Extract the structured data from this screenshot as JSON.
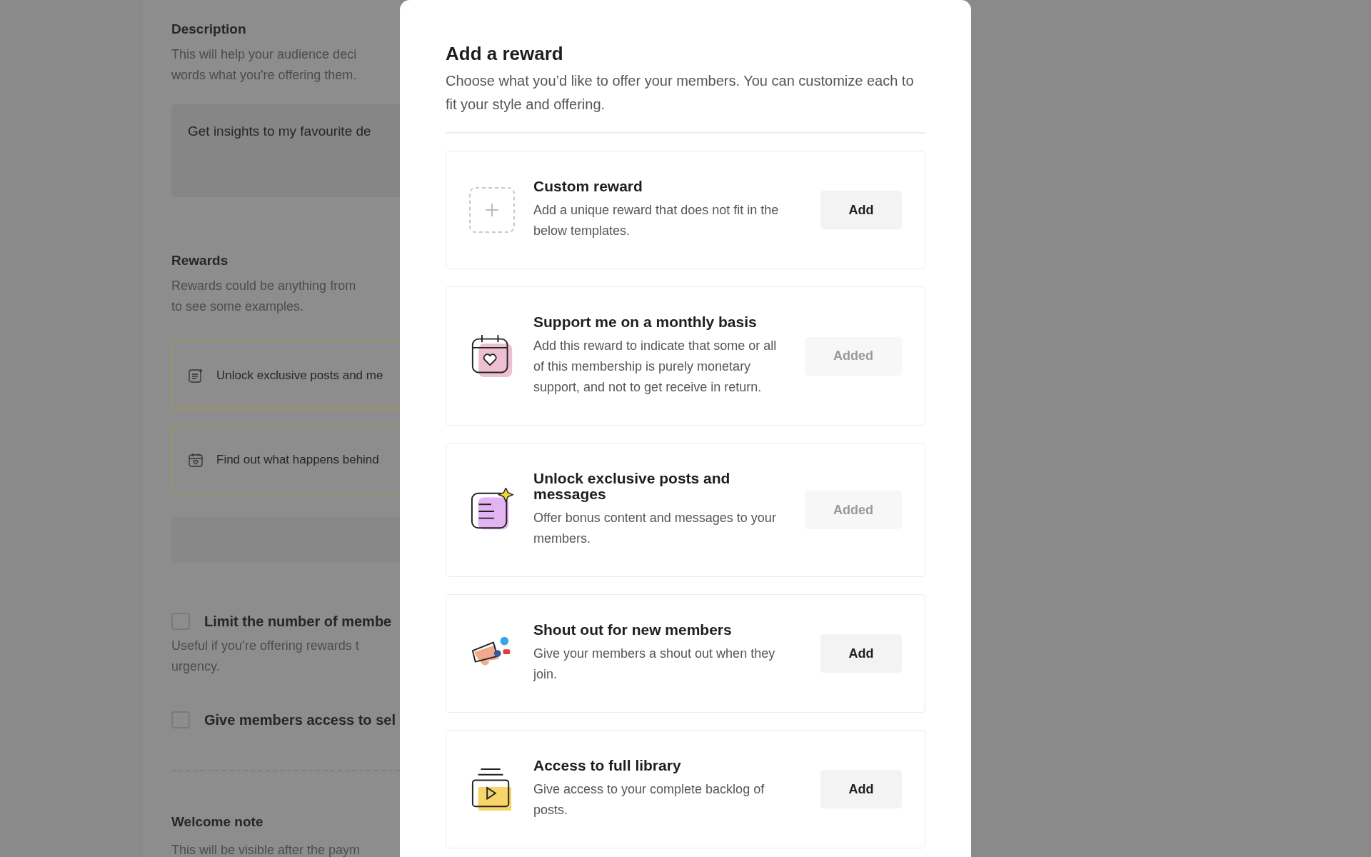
{
  "page": {
    "description": {
      "heading": "Description",
      "lines": [
        "This will help your audience deci",
        "words what you're offering them."
      ],
      "field_value": "Get insights to my favourite de"
    },
    "rewards": {
      "heading": "Rewards",
      "lines": [
        "Rewards could be anything from",
        "to see some examples."
      ],
      "items": [
        {
          "kind": "posts",
          "label": "Unlock exclusive posts and me"
        },
        {
          "kind": "calendar",
          "label": "Find out what happens behind"
        }
      ]
    },
    "options": [
      {
        "label": "Limit the number of membe",
        "checked": false,
        "hint_lines": [
          "Useful if you’re offering rewards t",
          "urgency."
        ]
      },
      {
        "label": "Give members access to sel",
        "checked": false
      }
    ],
    "welcome": {
      "heading": "Welcome note",
      "text": "This will be visible after the paym"
    }
  },
  "modal": {
    "title": "Add a reward",
    "subtitle": "Choose what you’d like to offer your members. You can customize each to fit your style and offering.",
    "rewards": [
      {
        "kind": "custom",
        "title": "Custom reward",
        "description": "Add a unique reward that does not fit in the below templates.",
        "button": "Add",
        "added": false
      },
      {
        "kind": "calendar",
        "title": "Support me on a monthly basis",
        "description": "Add this reward to indicate that some or all of this membership is purely monetary support, and not to get receive in return.",
        "button": "Added",
        "added": true
      },
      {
        "kind": "posts",
        "title": "Unlock exclusive posts and messages",
        "description": "Offer bonus content and messages to your members.",
        "button": "Added",
        "added": true
      },
      {
        "kind": "shoutout",
        "title": "Shout out for new members",
        "description": "Give your members a shout out when they join.",
        "button": "Add",
        "added": false
      },
      {
        "kind": "library",
        "title": "Access to full library",
        "description": "Give access to your complete backlog of posts.",
        "button": "Add",
        "added": false
      }
    ]
  }
}
